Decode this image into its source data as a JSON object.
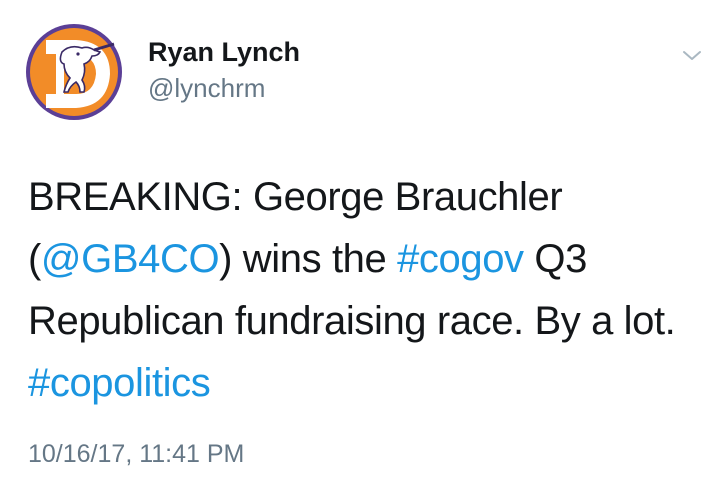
{
  "tweet": {
    "author": {
      "name": "Ryan Lynch",
      "handle": "@lynchrm",
      "avatar_icon": "broncos-logo-avatar"
    },
    "menu_icon": "chevron-down-icon",
    "text": {
      "line1": "BREAKING: George Brauchler",
      "line2_open": "(",
      "mention": "@GB4CO",
      "line2_mid": ") wins the ",
      "hashtag1": "#cogov",
      "line2_end": " Q3",
      "line3": "Republican fundraising race. By a lot.",
      "hashtag2": "#copolitics"
    },
    "timestamp": "10/16/17, 11:41 PM"
  },
  "colors": {
    "link": "#1b95e0",
    "secondary_text": "#657786",
    "primary_text": "#14171a",
    "avatar_ring": "#6a4fa3",
    "avatar_fill": "#f28c28"
  }
}
